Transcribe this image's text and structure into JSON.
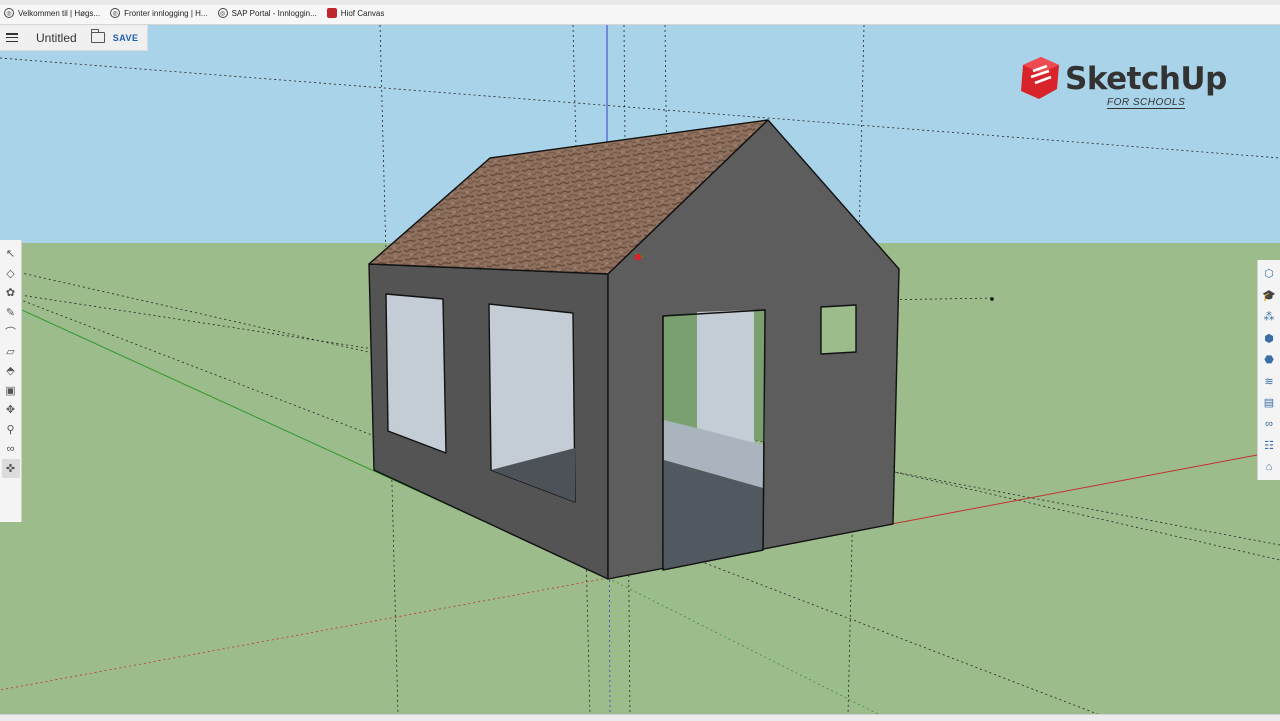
{
  "bookmarks": [
    {
      "label": "Velkommen til | Høgs...",
      "icon": "globe-icon"
    },
    {
      "label": "Fronter innlogging | H...",
      "icon": "globe-icon"
    },
    {
      "label": "SAP Portal - Innloggin...",
      "icon": "globe-icon"
    },
    {
      "label": "Hiof Canvas",
      "icon": "canvas-icon"
    }
  ],
  "app": {
    "doc_title": "Untitled",
    "save_label": "SAVE"
  },
  "logo": {
    "name": "SketchUp",
    "tagline": "FOR SCHOOLS"
  },
  "colors": {
    "sky": "#a9d3e8",
    "ground": "#9cbc8c",
    "wall": "#585858",
    "window": "#c4cdd5",
    "roof": "#8b6d5c",
    "accent": "#1a5fb4",
    "logo_red": "#d8232a"
  },
  "toolbar_left": [
    {
      "name": "select-tool-icon",
      "glyph": "↖"
    },
    {
      "name": "eraser-tool-icon",
      "glyph": "◇"
    },
    {
      "name": "paint-bucket-icon",
      "glyph": "✿"
    },
    {
      "name": "pencil-tool-icon",
      "glyph": "✎"
    },
    {
      "name": "arc-tool-icon",
      "glyph": "⌒"
    },
    {
      "name": "rectangle-tool-icon",
      "glyph": "▱"
    },
    {
      "name": "push-pull-tool-icon",
      "glyph": "⬘"
    },
    {
      "name": "offset-tool-icon",
      "glyph": "▣"
    },
    {
      "name": "move-tool-icon",
      "glyph": "✥"
    },
    {
      "name": "tape-measure-icon",
      "glyph": "⚲"
    },
    {
      "name": "walk-tool-icon",
      "glyph": "∞"
    },
    {
      "name": "orbit-tool-icon",
      "glyph": "✜"
    }
  ],
  "toolbar_right": [
    {
      "name": "entity-info-icon",
      "glyph": "⬡"
    },
    {
      "name": "instructor-icon",
      "glyph": "🎓"
    },
    {
      "name": "components-icon",
      "glyph": "⁂"
    },
    {
      "name": "materials-icon",
      "glyph": "⬢"
    },
    {
      "name": "styles-icon",
      "glyph": "⬣"
    },
    {
      "name": "layers-icon",
      "glyph": "≋"
    },
    {
      "name": "scenes-icon",
      "glyph": "▤"
    },
    {
      "name": "display-icon",
      "glyph": "∞"
    },
    {
      "name": "outliner-icon",
      "glyph": "☷"
    },
    {
      "name": "extensions-icon",
      "glyph": "⌂"
    }
  ]
}
